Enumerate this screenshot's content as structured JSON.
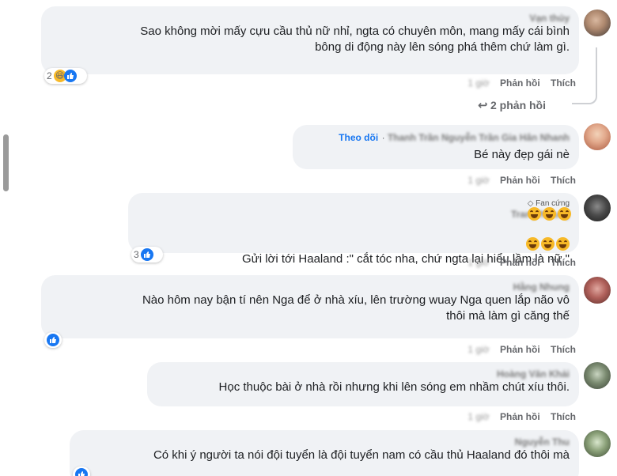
{
  "comments": [
    {
      "author": "Vạn thủy",
      "text": "Sao không mời mấy cựu cầu thủ nữ nhỉ, ngta có chuyên môn, mang mấy cái bình\nbông di động này lên sóng phá thêm chứ làm gì.",
      "actions": {
        "like": "Thích",
        "reply": "Phản hồi",
        "time": "1 giờ"
      },
      "reaction_count": "2",
      "replies_label": "2 phản hồi"
    },
    {
      "author": "Thanh Trần Nguyễn Trần Gia Hân Nhanh",
      "follow": "Theo dõi",
      "text": "Bé này đẹp gái nè",
      "actions": {
        "like": "Thích",
        "reply": "Phản hồi",
        "time": "1 giờ"
      }
    },
    {
      "badge": "Fan cứng",
      "author": "Trang Nhung",
      "text": "Gửi lời tới Haaland :\" cắt tóc nha, chứ ngta lại hiểu lầm là nữ \"",
      "actions": {
        "like": "Thích",
        "reply": "Phản hồi",
        "time": "1 giờ"
      },
      "reaction_count": "3"
    },
    {
      "author": "Hằng Nhung",
      "text": "Nào hôm nay bận tí nên Nga để ở nhà xíu, lên trường wuay Nga quen lắp não vô\nthôi mà làm gì căng thế",
      "actions": {
        "like": "Thích",
        "reply": "Phản hồi",
        "time": "1 giờ"
      }
    },
    {
      "author": "Hoàng Văn Khải",
      "text": "Học thuộc bài ở nhà rồi nhưng khi lên sóng em nhầm chút xíu thôi.",
      "actions": {
        "like": "Thích",
        "reply": "Phản hồi",
        "time": "1 giờ"
      }
    },
    {
      "author": "Nguyễn Thu",
      "text": "Có khi ý người ta nói đội tuyển là đội tuyển nam có cầu thủ Haaland đó thôi mà",
      "actions": {}
    }
  ],
  "icons": {
    "like": "like-icon",
    "haha": "haha-icon",
    "reply_arrow": "reply-arrow-icon",
    "fan_badge": "diamond-icon"
  },
  "colors": {
    "bubble": "#f0f2f5",
    "link": "#1877f2",
    "meta": "#65676b"
  }
}
